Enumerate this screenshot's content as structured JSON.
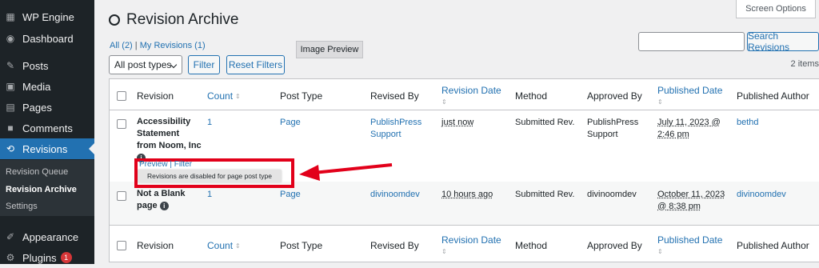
{
  "sidebar": {
    "items": [
      {
        "label": "WP Engine",
        "icon": "wp-engine-icon"
      },
      {
        "label": "Dashboard",
        "icon": "dashboard-icon"
      },
      {
        "label": "Posts",
        "icon": "pin-icon"
      },
      {
        "label": "Media",
        "icon": "media-icon"
      },
      {
        "label": "Pages",
        "icon": "pages-icon"
      },
      {
        "label": "Comments",
        "icon": "comments-icon"
      },
      {
        "label": "Revisions",
        "icon": "revisions-icon"
      },
      {
        "label": "Appearance",
        "icon": "appearance-icon"
      },
      {
        "label": "Plugins",
        "icon": "plugins-icon",
        "badge": "1"
      }
    ],
    "submenu": [
      "Revision Queue",
      "Revision Archive",
      "Settings"
    ]
  },
  "header": {
    "title": "Revision Archive",
    "screen_options": "Screen Options",
    "filter_all": "All (2)",
    "filter_sep": "|",
    "filter_mine": "My Revisions (1)",
    "image_preview": "Image Preview",
    "post_types": "All post types",
    "filter_button": "Filter",
    "reset_button": "Reset Filters",
    "search_button": "Search Revisions",
    "items_count": "2 items"
  },
  "table": {
    "columns": [
      "Revision",
      "Count",
      "Post Type",
      "Revised By",
      "Revision Date",
      "Method",
      "Approved By",
      "Published Date",
      "Published Author"
    ],
    "rows": [
      {
        "revision_lines": [
          "Accessibility",
          "Statement",
          "from Noom, Inc"
        ],
        "count": "1",
        "post_type": "Page",
        "revised_by_lines": [
          "PublishPress",
          "Support"
        ],
        "revision_date": "just now",
        "method": "Submitted Rev.",
        "approved_by_lines": [
          "PublishPress",
          "Support"
        ],
        "published_date_lines": [
          "July 11, 2023 @",
          "2:46 pm"
        ],
        "published_author": "bethd",
        "row_actions": "Preview | Filter"
      },
      {
        "revision_lines": [
          "Not a Blank",
          "page"
        ],
        "count": "1",
        "post_type": "Page",
        "revised_by_lines": [
          "divinoomdev"
        ],
        "revision_date": "10 hours ago",
        "method": "Submitted Rev.",
        "approved_by_lines": [
          "divinoomdev"
        ],
        "published_date_lines": [
          "October 11, 2023",
          "@ 8:38 pm"
        ],
        "published_author": "divinoomdev"
      }
    ]
  },
  "tooltip": "Revisions are disabled for page post type",
  "colors": {
    "accent": "#2271b1",
    "sidebar": "#1d2327",
    "callout": "#e2001a"
  }
}
